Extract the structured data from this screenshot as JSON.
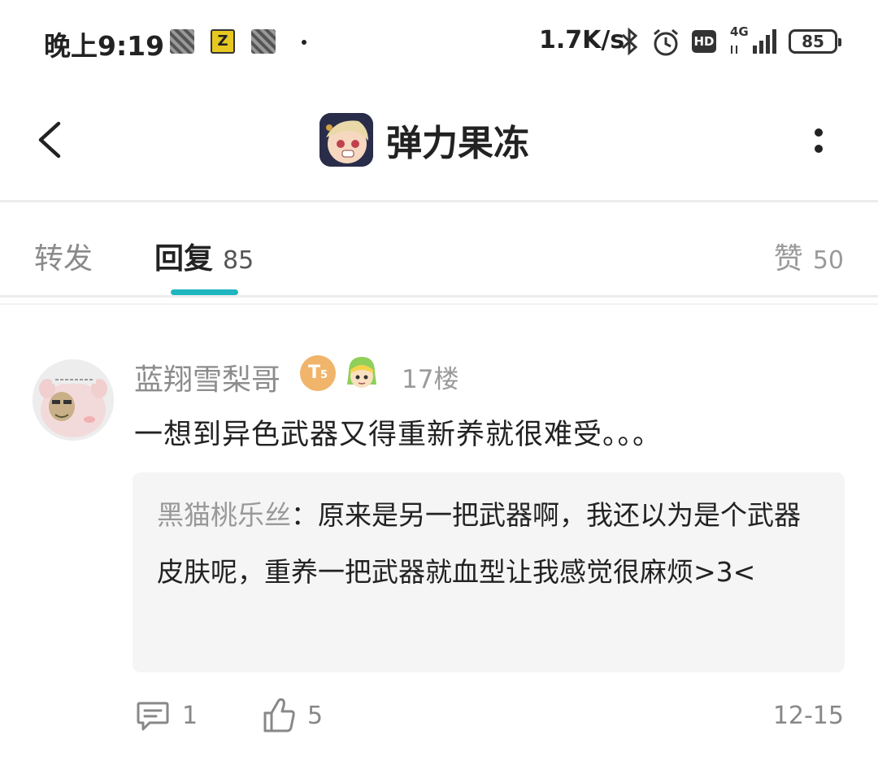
{
  "status_bar": {
    "time": "晚上9:19",
    "notification_icons": [
      "pattern-icon",
      "zapp-icon",
      "pattern-icon"
    ],
    "zapp_letter": "Z",
    "network_speed": "1.7K/s",
    "hd_label": "HD",
    "network_type": "4G",
    "battery": "85"
  },
  "header": {
    "title": "弹力果冻"
  },
  "tabs": {
    "forward_label": "转发",
    "reply_label": "回复",
    "reply_count": "85",
    "like_label": "赞",
    "like_count": "50"
  },
  "comment": {
    "username": "蓝翔雪梨哥",
    "level_badge": "T",
    "level_sub": "5",
    "floor": "17楼",
    "text": "一想到异色武器又得重新养就很难受。。。",
    "quote_author": "黑猫桃乐丝",
    "quote_separator": "：",
    "quote_text": "原来是另一把武器啊，我还以为是个武器皮肤呢，重养一把武器就血型让我感觉很麻烦>3<",
    "reply_count": "1",
    "like_count": "5",
    "date": "12-15"
  },
  "colors": {
    "accent": "#1fb5bf",
    "quote_bg": "#f5f5f5",
    "muted_text": "#8c8c8c",
    "level_badge": "#f0b56a"
  }
}
